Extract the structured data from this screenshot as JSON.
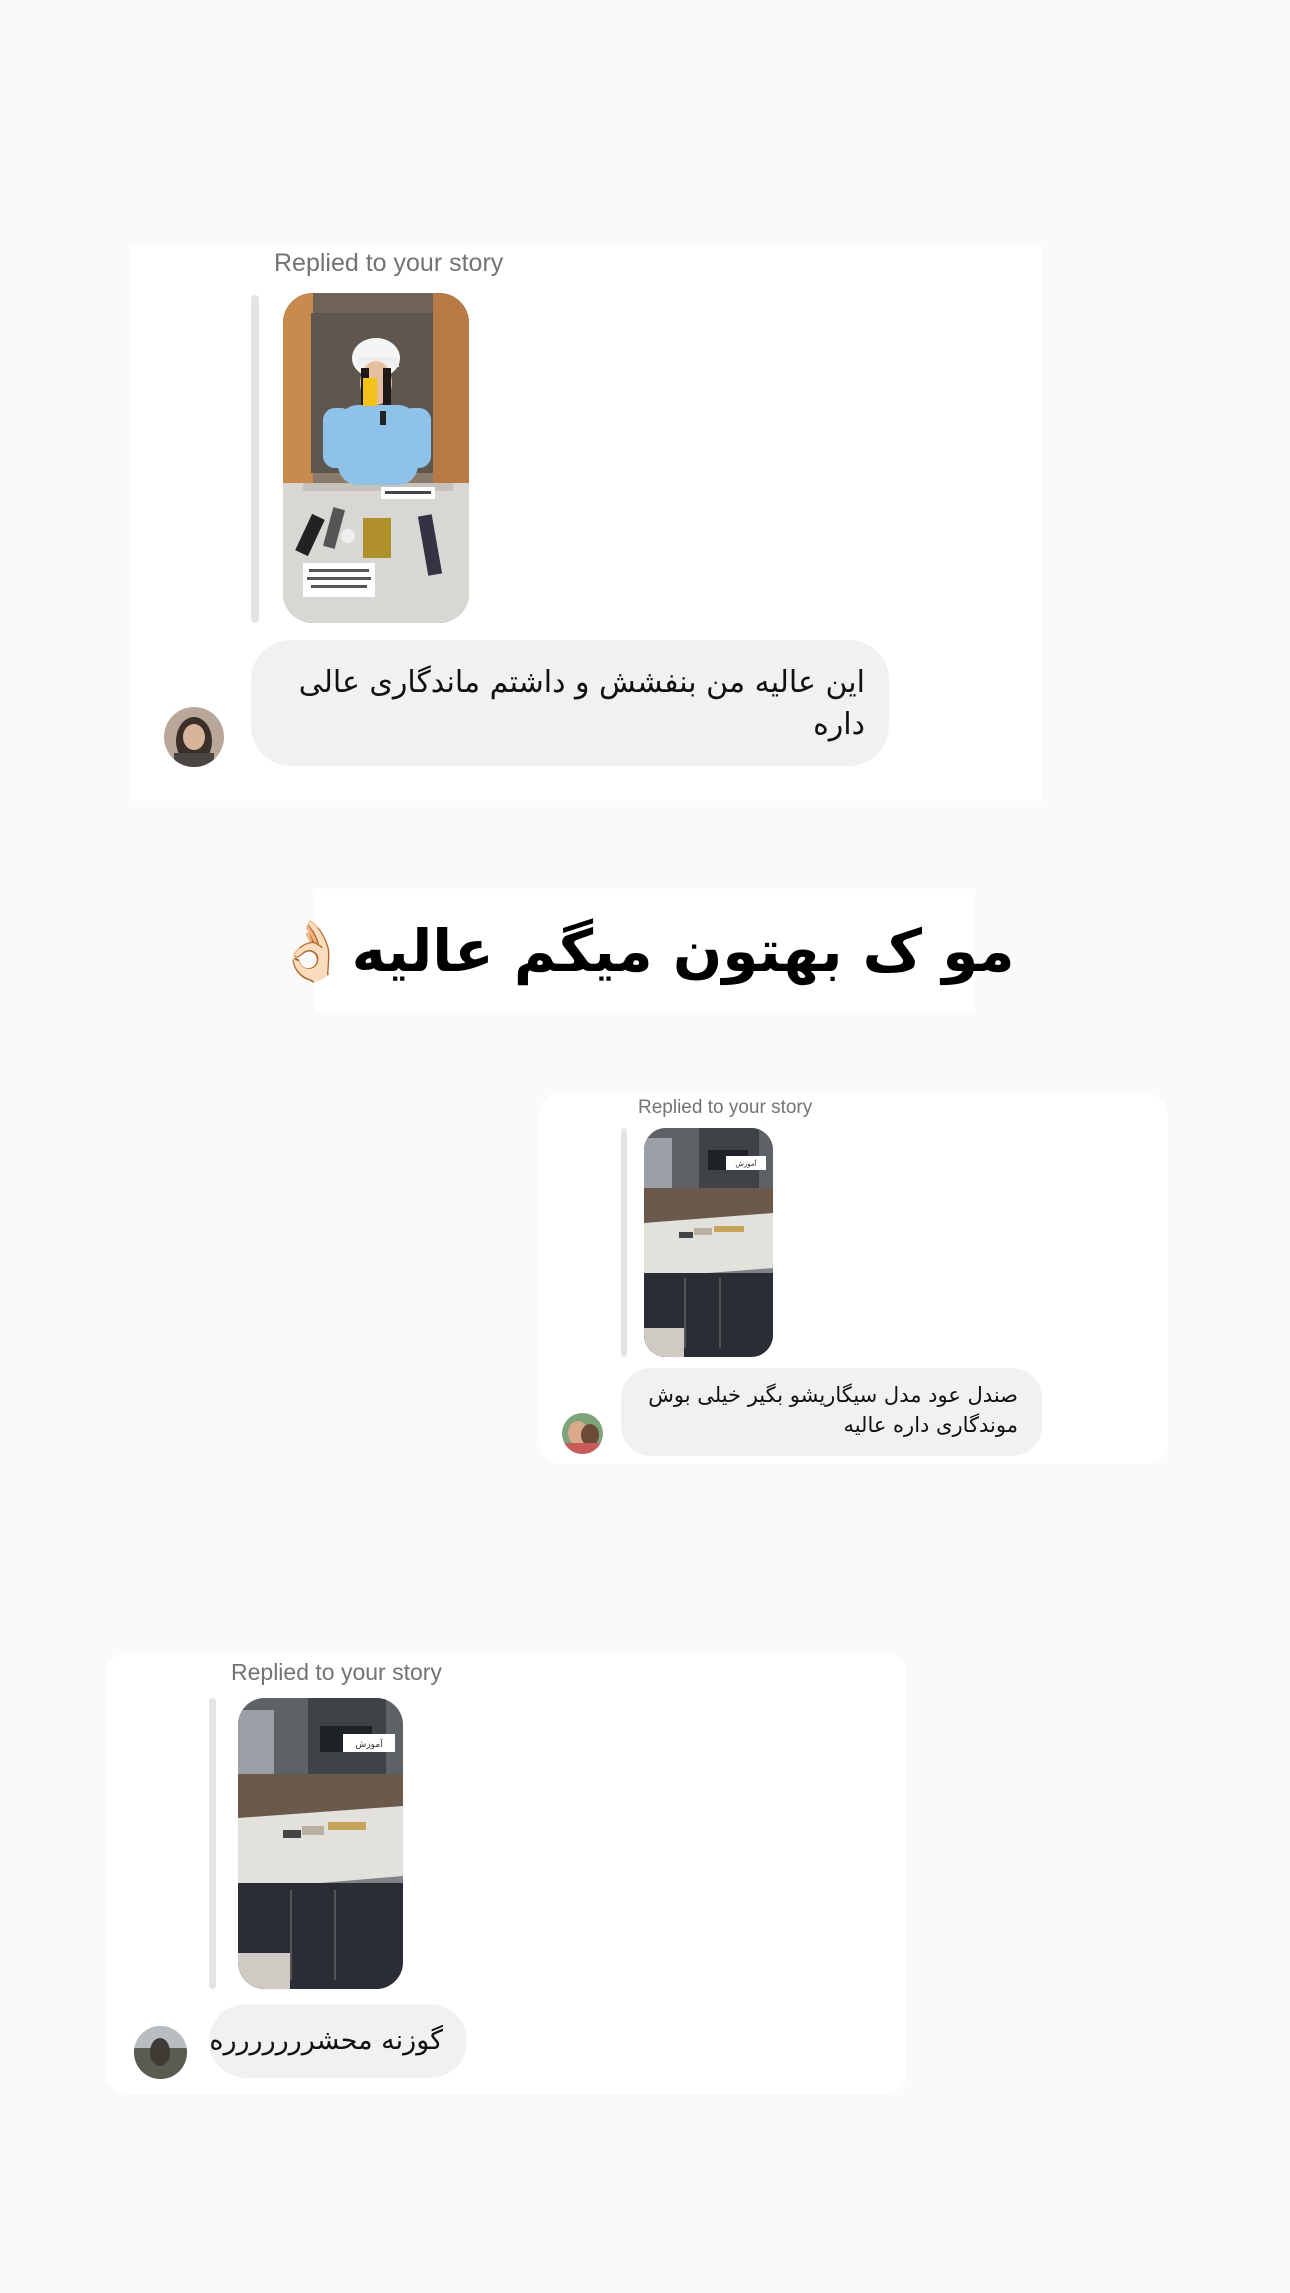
{
  "colors": {
    "page_bg": "#fafafa",
    "card_bg": "#ffffff",
    "bubble_bg": "#f0f1f3",
    "meta_text": "#737373"
  },
  "conversations": [
    {
      "replied_label": "Replied to your story",
      "message": "این عالیه من بنفشش و داشتم ماندگاری عالی داره",
      "story_sticker_lines": [
        "@artis_hesrow",
        "کاملا ضد عوض گیره.",
        "ادکلن مکانی روی پیوسته کسی یادت می‌گیرن"
      ]
    },
    {
      "replied_label": "Replied to your story",
      "message": "صندل عود مدل سیگاریشو بگیر خیلی بوش موندگاری داره عالیه",
      "story_badge": "آموزش"
    },
    {
      "replied_label": "Replied to your story",
      "message": "گوزنه محشررررررره",
      "story_badge": "آموزش"
    }
  ],
  "banner": {
    "text": "مو ک بهتون میگم عالیه",
    "emoji": "👌🏻"
  }
}
